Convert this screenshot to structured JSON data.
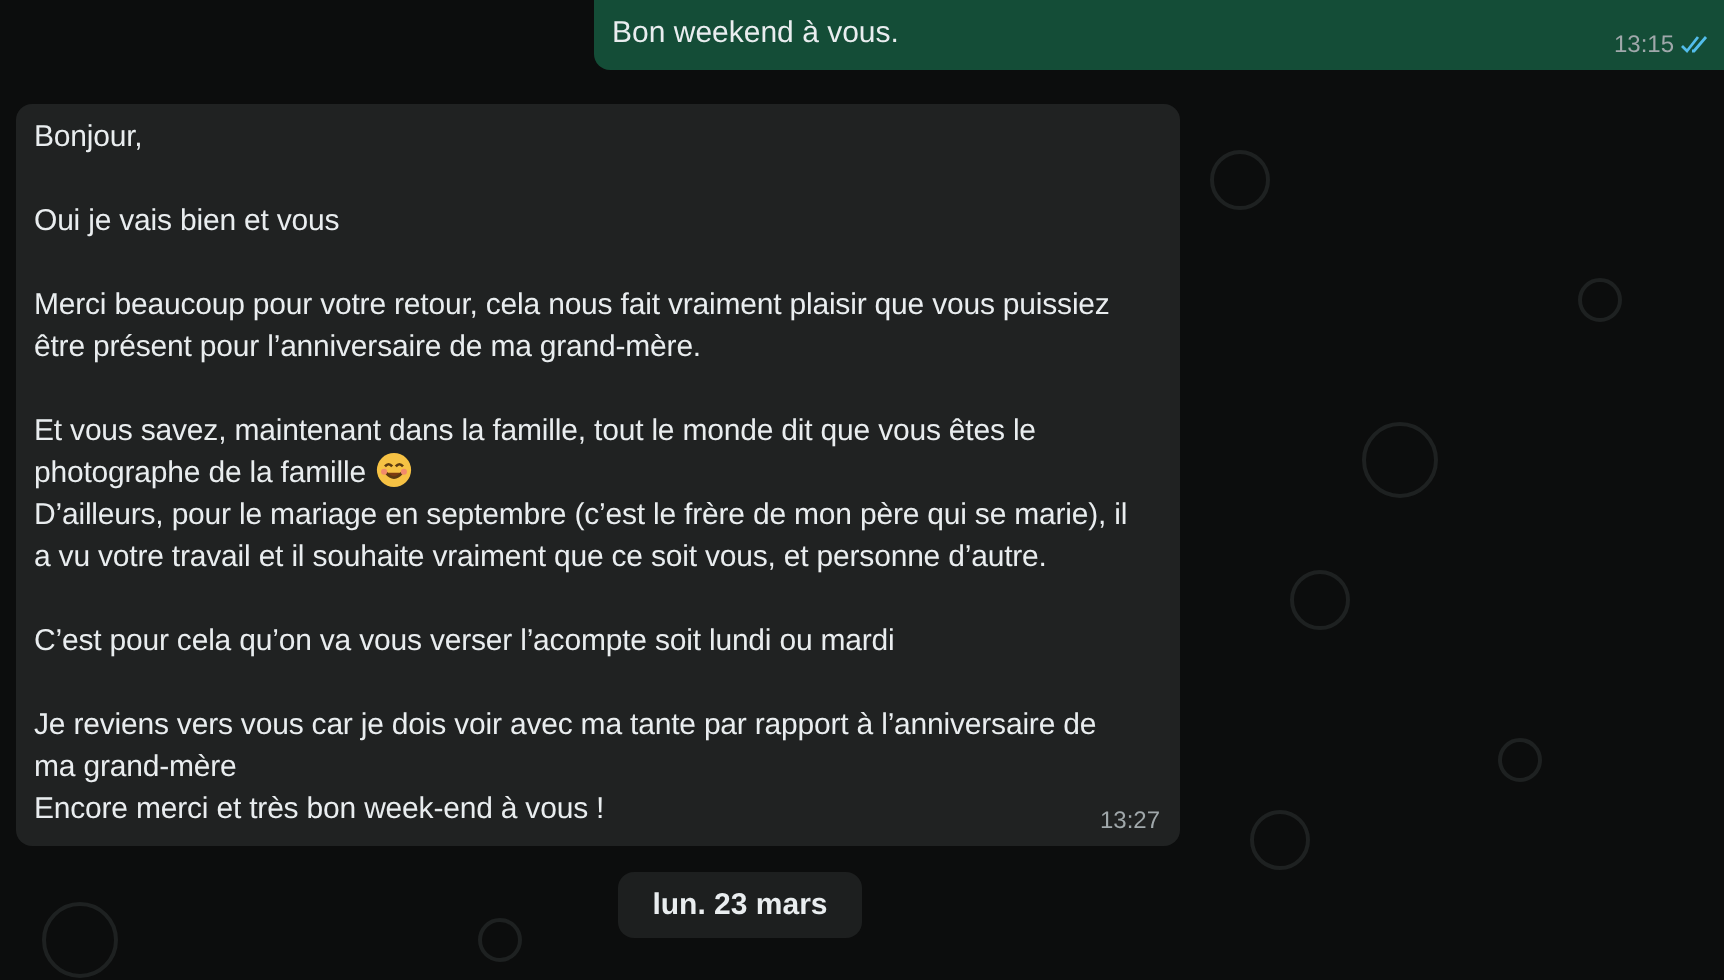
{
  "outgoing_message": {
    "text": "Bon weekend à vous.",
    "time": "13:15",
    "read": true
  },
  "incoming_message": {
    "time": "13:27",
    "blocks": [
      [
        {
          "text": "Bonjour,",
          "emoji": false
        }
      ],
      [
        {
          "text": "Oui je vais bien et vous",
          "emoji": false
        }
      ],
      [
        {
          "text": "Merci beaucoup pour votre retour, cela nous fait vraiment plaisir que vous puissiez être présent pour l’anniversaire de ma grand-mère.",
          "emoji": false
        }
      ],
      [
        {
          "text": "Et vous savez, maintenant dans la famille, tout le monde dit que vous êtes le photographe de la famille",
          "emoji": true
        },
        {
          "text": "D’ailleurs, pour le mariage en septembre (c’est le frère de mon père qui se marie), il a vu votre travail et il souhaite vraiment que ce soit vous, et personne d’autre.",
          "emoji": false
        }
      ],
      [
        {
          "text": "C’est pour cela qu’on va vous verser l’acompte soit lundi ou mardi",
          "emoji": false
        }
      ],
      [
        {
          "text": "Je reviens vers vous car je dois voir avec ma tante par rapport à l’anniversaire de ma grand-mère",
          "emoji": false
        },
        {
          "text": "Encore merci et très bon week-end à vous !",
          "emoji": false
        }
      ]
    ]
  },
  "date_separator": "lun. 23 mars"
}
